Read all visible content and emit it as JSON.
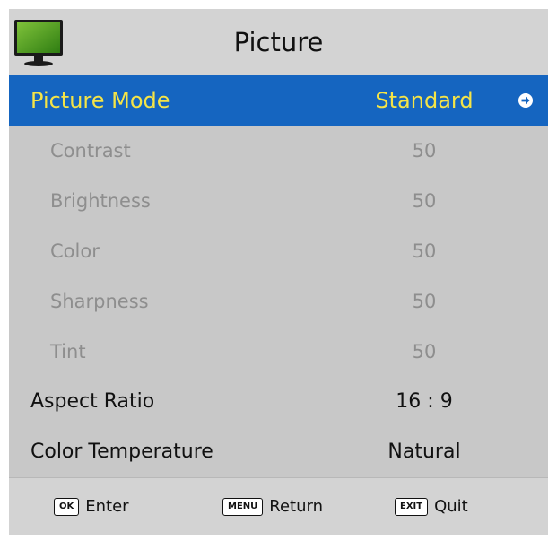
{
  "header": {
    "title": "Picture",
    "icon": "tv-icon"
  },
  "menu": {
    "picture_mode": {
      "label": "Picture Mode",
      "value": "Standard"
    },
    "contrast": {
      "label": "Contrast",
      "value": "50"
    },
    "brightness": {
      "label": "Brightness",
      "value": "50"
    },
    "color": {
      "label": "Color",
      "value": "50"
    },
    "sharpness": {
      "label": "Sharpness",
      "value": "50"
    },
    "tint": {
      "label": "Tint",
      "value": "50"
    },
    "aspect_ratio": {
      "label": "Aspect Ratio",
      "value": "16 : 9"
    },
    "color_temperature": {
      "label": "Color Temperature",
      "value": "Natural"
    }
  },
  "footer": {
    "ok": {
      "key": "OK",
      "action": "Enter"
    },
    "menu": {
      "key": "MENU",
      "action": "Return"
    },
    "exit": {
      "key": "EXIT",
      "action": "Quit"
    }
  },
  "colors": {
    "highlight_bg": "#1565c0",
    "highlight_text": "#f5e447",
    "panel_bg": "#c8c8c8",
    "disabled_text": "#8e8e8e"
  }
}
